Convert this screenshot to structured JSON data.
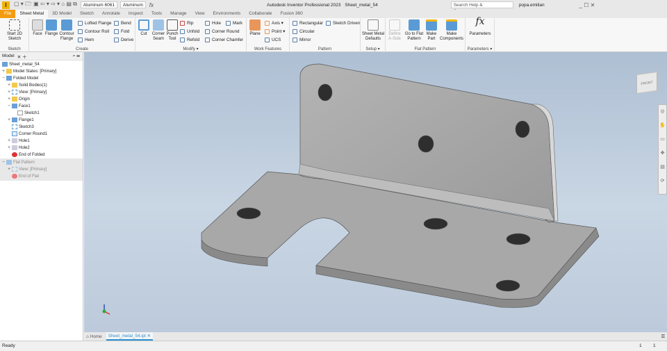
{
  "title": {
    "app": "Autodesk Inventor Professional 2023",
    "doc": "Sheet_metal_54",
    "search_placeholder": "Search Help & Commands...",
    "user": "popa.emilian",
    "material": "Aluminum 6061",
    "appearance": "Aluminum",
    "fx": "fx"
  },
  "tabs": [
    "File",
    "Sheet Metal",
    "3D Model",
    "Sketch",
    "Annotate",
    "Inspect",
    "Tools",
    "Manage",
    "View",
    "Environments",
    "Collaborate",
    "Fusion 360"
  ],
  "ribbon": {
    "sketch": {
      "label": "Sketch",
      "start": "Start 2D Sketch"
    },
    "create": {
      "label": "Create",
      "face": "Face",
      "flange": "Flange",
      "contour": "Contour Flange",
      "lofted": "Lofted Flange",
      "contour_roll": "Contour Roll",
      "hem": "Hem",
      "bend": "Bend",
      "fold": "Fold",
      "derive": "Derive"
    },
    "modify": {
      "label": "Modify ▾",
      "cut": "Cut",
      "corner_seam": "Corner Seam",
      "punch": "Punch Tool",
      "rip": "Rip",
      "unfold": "Unfold",
      "refold": "Refold",
      "hole": "Hole",
      "mark": "Mark",
      "corner_round": "Corner Round",
      "corner_chamfer": "Corner Chamfer"
    },
    "work": {
      "label": "Work Features",
      "plane": "Plane",
      "axis": "Axis ▾",
      "point": "Point ▾",
      "ucs": "UCS"
    },
    "pattern": {
      "label": "Pattern",
      "rect": "Rectangular",
      "circ": "Circular",
      "mirror": "Mirror",
      "sketch_driven": "Sketch Driven"
    },
    "setup": {
      "label": "Setup ▾",
      "defaults": "Sheet Metal Defaults"
    },
    "flat": {
      "label": "Flat Pattern",
      "define": "Define A-Side",
      "goto": "Go to Flat Pattern",
      "make_part": "Make Part",
      "make_comp": "Make Components"
    },
    "params": {
      "label": "Parameters ▾",
      "btn": "Parameters"
    }
  },
  "browser": {
    "tab": "Model",
    "nodes": [
      "Sheet_metal_54",
      "Model States: [Primary]",
      "Folded Model",
      "Solid Bodies(1)",
      "View: [Primary]",
      "Origin",
      "Face1",
      "Sketch1",
      "Flange1",
      "Sketch3",
      "Corner Round1",
      "Hole1",
      "Hole2",
      "End of Folded",
      "Flat Pattern",
      "View: [Primary]",
      "End of Flat"
    ]
  },
  "viewcube": "FRONT",
  "doctabs": {
    "home": "Home",
    "file": "Sheet_metal_54.ipt"
  },
  "status": {
    "text": "Ready",
    "n1": "1",
    "n2": "1"
  },
  "colors": {
    "file_tab": "#f39c12",
    "part": "#a9a9a9"
  }
}
